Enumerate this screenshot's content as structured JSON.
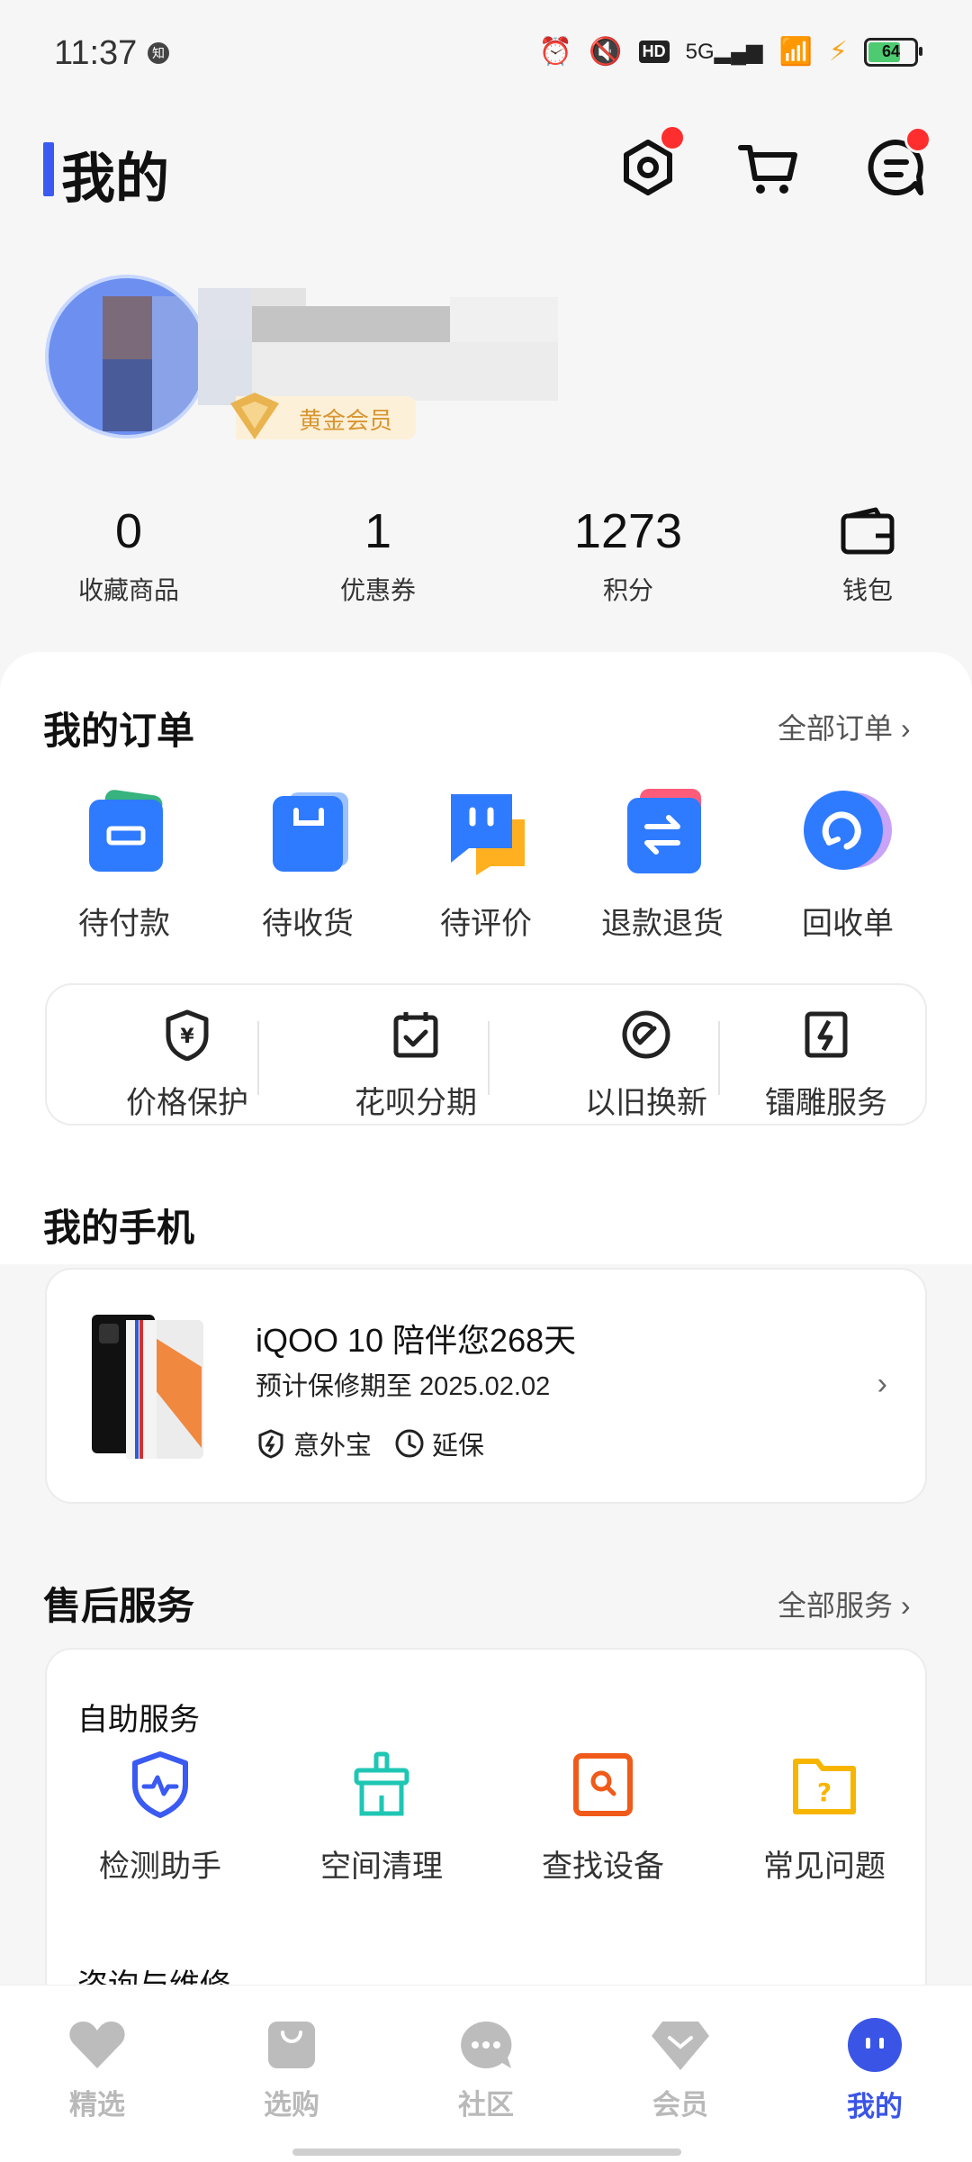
{
  "status_bar": {
    "time": "11:37",
    "zhi_badge": "知",
    "hd": "HD",
    "network": "5G",
    "battery": "64"
  },
  "header": {
    "title": "我的"
  },
  "profile": {
    "member_badge": "黄金会员"
  },
  "stats": [
    {
      "value": "0",
      "label": "收藏商品"
    },
    {
      "value": "1",
      "label": "优惠券"
    },
    {
      "value": "1273",
      "label": "积分"
    },
    {
      "label": "钱包"
    }
  ],
  "orders": {
    "title": "我的订单",
    "all_link": "全部订单 ›",
    "items": [
      {
        "label": "待付款"
      },
      {
        "label": "待收货"
      },
      {
        "label": "待评价"
      },
      {
        "label": "退款退货"
      },
      {
        "label": "回收单"
      }
    ]
  },
  "quick": [
    {
      "label": "价格保护"
    },
    {
      "label": "花呗分期"
    },
    {
      "label": "以旧换新"
    },
    {
      "label": "镭雕服务"
    }
  ],
  "my_phone": {
    "title": "我的手机",
    "device": "iQOO 10 陪伴您268天",
    "warranty": "预计保修期至 2025.02.02",
    "tags": [
      "意外宝",
      "延保"
    ]
  },
  "after_sales": {
    "title": "售后服务",
    "all_link": "全部服务 ›",
    "self_service": "自助服务",
    "items": [
      {
        "label": "检测助手"
      },
      {
        "label": "空间清理"
      },
      {
        "label": "查找设备"
      },
      {
        "label": "常见问题"
      }
    ],
    "repair": "咨询与维修"
  },
  "nav": [
    {
      "label": "精选"
    },
    {
      "label": "选购"
    },
    {
      "label": "社区"
    },
    {
      "label": "会员"
    },
    {
      "label": "我的"
    }
  ],
  "colors": {
    "accent": "#3a55e6",
    "order_blue": "#2f7bff",
    "reddot": "#ff2e2e"
  }
}
